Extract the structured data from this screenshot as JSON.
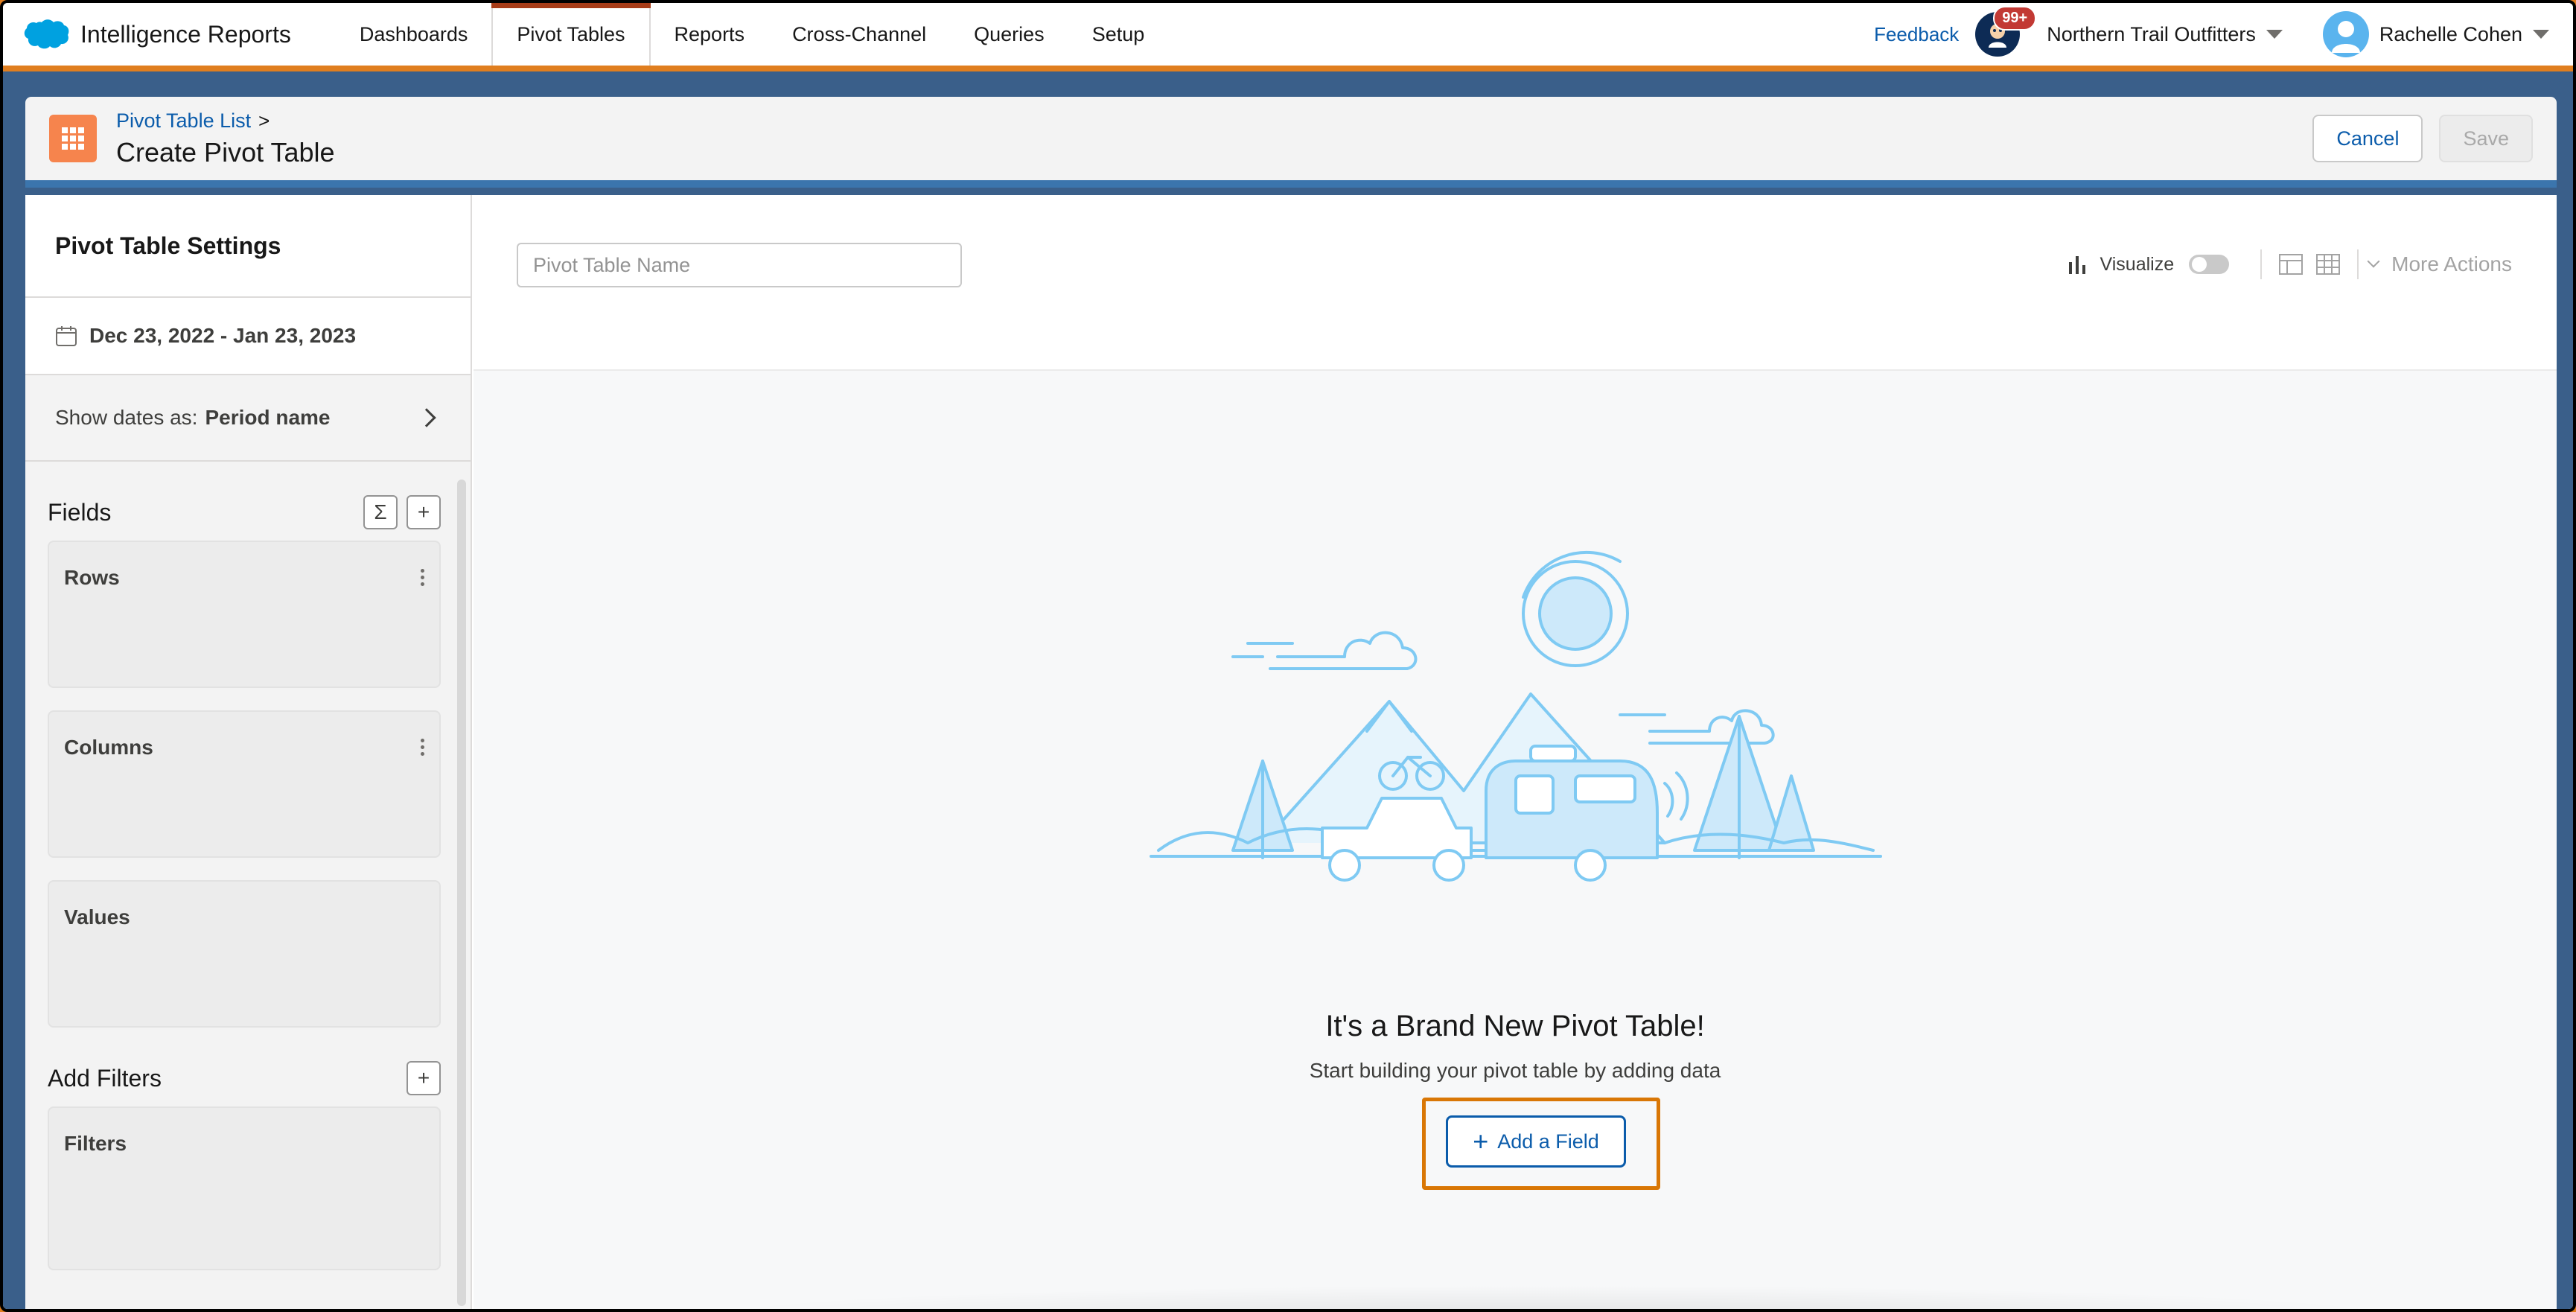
{
  "app": {
    "name": "Intelligence Reports",
    "nav": [
      {
        "label": "Dashboards",
        "active": false
      },
      {
        "label": "Pivot Tables",
        "active": true
      },
      {
        "label": "Reports",
        "active": false
      },
      {
        "label": "Cross-Channel",
        "active": false
      },
      {
        "label": "Queries",
        "active": false
      },
      {
        "label": "Setup",
        "active": false
      }
    ],
    "feedback_label": "Feedback",
    "notification_badge": "99+",
    "org_name": "Northern Trail Outfitters",
    "user_name": "Rachelle Cohen"
  },
  "page_header": {
    "breadcrumb": "Pivot Table List",
    "breadcrumb_separator": ">",
    "title": "Create Pivot Table",
    "cancel_label": "Cancel",
    "save_label": "Save"
  },
  "sidebar": {
    "settings_title": "Pivot Table Settings",
    "date_range": "Dec 23, 2022 - Jan 23, 2023",
    "show_dates_label": "Show dates as:",
    "show_dates_value": "Period name",
    "fields_label": "Fields",
    "sum_symbol": "Σ",
    "plus_symbol": "+",
    "rows_label": "Rows",
    "columns_label": "Columns",
    "values_label": "Values",
    "add_filters_label": "Add Filters",
    "filters_label": "Filters"
  },
  "main": {
    "name_placeholder": "Pivot Table Name",
    "visualize_label": "Visualize",
    "more_actions_label": "More Actions",
    "empty_title": "It's a Brand New Pivot Table!",
    "empty_subtitle": "Start building your pivot table by adding data",
    "add_field_plus": "+",
    "add_field_label": "Add a Field"
  },
  "colors": {
    "brand_blue": "#0b5cab",
    "accent_orange": "#e07e1f",
    "active_tab": "#a73c18",
    "icon_orange": "#f6844d",
    "badge_red": "#c23934",
    "illustration_blue": "#7fcaf3"
  }
}
